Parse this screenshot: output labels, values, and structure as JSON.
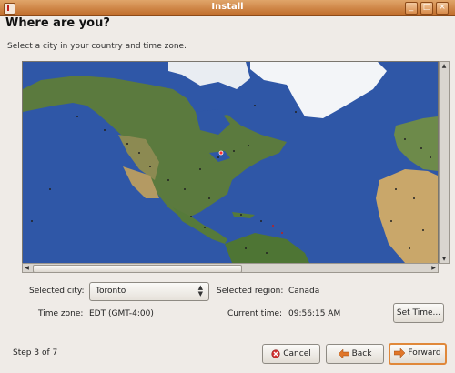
{
  "window": {
    "title": "Install",
    "minimize_glyph": "_",
    "maximize_glyph": "□",
    "close_glyph": "×"
  },
  "page": {
    "heading": "Where are you?",
    "instruction": "Select a city in your country and time zone."
  },
  "map": {
    "scroll_up_glyph": "▲",
    "scroll_down_glyph": "▼",
    "scroll_left_glyph": "◀",
    "scroll_right_glyph": "▶",
    "colors": {
      "ocean": "#2f57a7",
      "ice": "#f3f5f8",
      "land": "#5b7a3e",
      "desert": "#b49a63"
    }
  },
  "fields": {
    "city_label": "Selected city:",
    "city_value": "Toronto",
    "region_label": "Selected region:",
    "region_value": "Canada",
    "timezone_label": "Time zone:",
    "timezone_value": "EDT (GMT-4:00)",
    "time_label": "Current time:",
    "time_value": "09:56:15 AM"
  },
  "buttons": {
    "set_time": "Set Time...",
    "cancel": "Cancel",
    "back": "Back",
    "forward": "Forward"
  },
  "footer": {
    "step": "Step 3 of 7"
  },
  "icons": {
    "app": "ubuntu-installer-icon",
    "cancel": "cancel-icon",
    "back": "arrow-left-icon",
    "forward": "arrow-right-icon"
  }
}
